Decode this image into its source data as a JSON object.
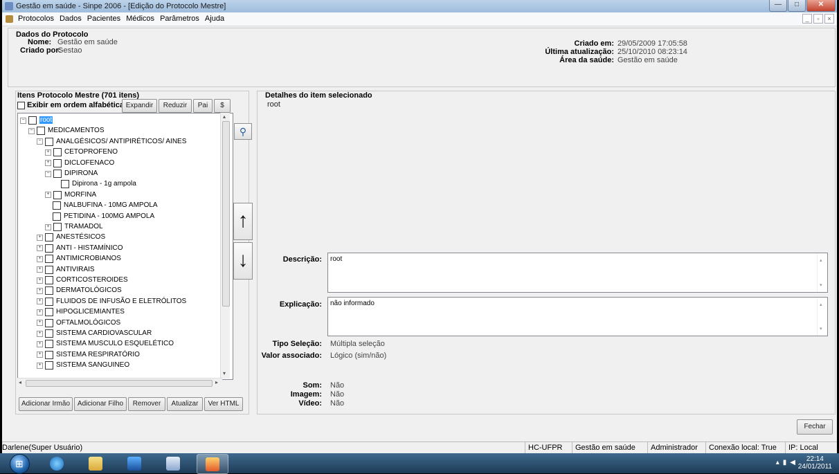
{
  "window": {
    "title": "Gestão em saúde - Sinpe 2006 - [Edição do Protocolo Mestre]"
  },
  "menu": {
    "items": [
      "Protocolos",
      "Dados",
      "Pacientes",
      "Médicos",
      "Parâmetros",
      "Ajuda"
    ]
  },
  "protocol": {
    "group_title": "Dados do Protocolo",
    "nome_label": "Nome:",
    "nome_value": "Gestão em saúde",
    "criado_por_label": "Criado por:",
    "criado_por_value": "Gestao",
    "criado_em_label": "Criado em:",
    "criado_em_value": "29/05/2009 17:05:58",
    "ultima_label": "Última atualização:",
    "ultima_value": "25/10/2010 08:23:14",
    "area_label": "Área da saúde:",
    "area_value": "Gestão em saúde"
  },
  "items_panel": {
    "title": "Itens Protocolo Mestre (701 itens)",
    "alphabetical_label": "Exibir em ordem alfabética",
    "buttons": {
      "expand": "Expandir",
      "reduce": "Reduzir",
      "parent": "Pai",
      "dollar": "$"
    },
    "tree": [
      {
        "label": "root",
        "level": 0,
        "expander": "⊟",
        "selected": true
      },
      {
        "label": "MEDICAMENTOS",
        "level": 1,
        "expander": "⊟"
      },
      {
        "label": "ANALGÉSICOS/ ANTIPIRÉTICOS/ AINES",
        "level": 2,
        "expander": "⊟"
      },
      {
        "label": "CETOPROFENO",
        "level": 3,
        "expander": "⊞"
      },
      {
        "label": "DICLOFENACO",
        "level": 3,
        "expander": "⊞"
      },
      {
        "label": "DIPIRONA",
        "level": 3,
        "expander": "⊟"
      },
      {
        "label": "Dipirona - 1g ampola",
        "level": 4,
        "expander": ""
      },
      {
        "label": "MORFINA",
        "level": 3,
        "expander": "⊞"
      },
      {
        "label": "NALBUFINA - 10MG AMPOLA",
        "level": 3,
        "expander": ""
      },
      {
        "label": "PETIDINA - 100MG AMPOLA",
        "level": 3,
        "expander": ""
      },
      {
        "label": "TRAMADOL",
        "level": 3,
        "expander": "⊞"
      },
      {
        "label": "ANESTÉSICOS",
        "level": 2,
        "expander": "⊞"
      },
      {
        "label": "ANTI - HISTAMÍNICO",
        "level": 2,
        "expander": "⊞"
      },
      {
        "label": "ANTIMICROBIANOS",
        "level": 2,
        "expander": "⊞"
      },
      {
        "label": "ANTIVIRAIS",
        "level": 2,
        "expander": "⊞"
      },
      {
        "label": "CORTICOSTEROIDES",
        "level": 2,
        "expander": "⊞"
      },
      {
        "label": "DERMATOLÓGICOS",
        "level": 2,
        "expander": "⊞"
      },
      {
        "label": "FLUIDOS DE INFUSÃO E ELETRÓLITOS",
        "level": 2,
        "expander": "⊞"
      },
      {
        "label": "HIPOGLICEMIANTES",
        "level": 2,
        "expander": "⊞"
      },
      {
        "label": "OFTALMOLÓGICOS",
        "level": 2,
        "expander": "⊞"
      },
      {
        "label": "SISTEMA CARDIOVASCULAR",
        "level": 2,
        "expander": "⊞"
      },
      {
        "label": "SISTEMA MUSCULO ESQUELÉTICO",
        "level": 2,
        "expander": "⊞"
      },
      {
        "label": "SISTEMA RESPIRATÓRIO",
        "level": 2,
        "expander": "⊞"
      },
      {
        "label": "SISTEMA SANGUINEO",
        "level": 2,
        "expander": "⊞"
      }
    ],
    "bottom_buttons": {
      "add_sibling": "Adicionar Irmão",
      "add_child": "Adicionar Filho",
      "remove": "Remover",
      "update": "Atualizar",
      "view_html": "Ver HTML"
    }
  },
  "details": {
    "title": "Detalhes do item selecionado",
    "selected_name": "root",
    "descricao_label": "Descrição:",
    "descricao_value": "root",
    "explicacao_label": "Explicação:",
    "explicacao_value": "não informado",
    "tipo_label": "Tipo Seleção:",
    "tipo_value": "Múltipla seleção",
    "valor_label": "Valor associado:",
    "valor_value": "Lógico (sim/não)",
    "som_label": "Som:",
    "som_value": "Não",
    "imagem_label": "Imagem:",
    "imagem_value": "Não",
    "video_label": "Vídeo:",
    "video_value": "Não"
  },
  "close_button": "Fechar",
  "status": {
    "user": "Darlene(Super Usuário)",
    "org": "HC-UFPR",
    "app": "Gestão em saúde",
    "role": "Administrador",
    "conn": "Conexão local: True",
    "ip": "IP: Local"
  },
  "taskbar": {
    "time": "22:14",
    "date": "24/01/2011"
  },
  "colors": {
    "selection": "#3399ff",
    "titlebar": "#a9c3e0",
    "taskbar": "#2a4d6e"
  }
}
